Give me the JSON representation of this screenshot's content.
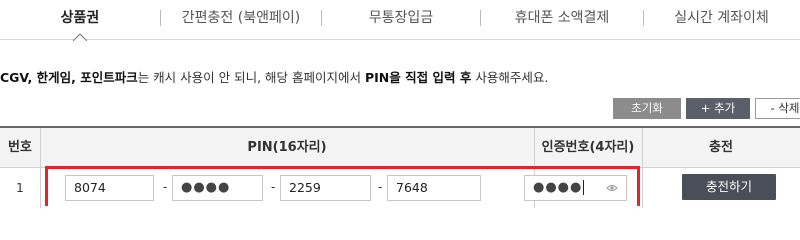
{
  "tabs": [
    {
      "label": "상품권",
      "active": true
    },
    {
      "label": "간편충전 (북앤페이)",
      "active": false
    },
    {
      "label": "무통장입금",
      "active": false
    },
    {
      "label": "휴대폰 소액결제",
      "active": false
    },
    {
      "label": "실시간 계좌이체",
      "active": false
    }
  ],
  "notice": {
    "part1": "CGV, 한게임, 포인트파크",
    "part2": "는 캐시 사용이 안 되니, 해당 홈페이지에서 ",
    "part3": "PIN을 직접 입력 후",
    "part4": " 사용해주세요."
  },
  "buttons": {
    "reset": "초기화",
    "add": "+ 추가",
    "delete": "- 삭제"
  },
  "table": {
    "headers": {
      "number": "번호",
      "pin": "PIN(16자리)",
      "auth": "인증번호(4자리)",
      "charge": "충전"
    },
    "rows": [
      {
        "number": "1",
        "pin": [
          "8074",
          "●●●●",
          "2259",
          "7648"
        ],
        "auth": "●●●●",
        "charge_label": "충전하기"
      }
    ],
    "separator": "-"
  },
  "colors": {
    "highlight": "#e2252b",
    "charge_button": "#4a4e59"
  }
}
